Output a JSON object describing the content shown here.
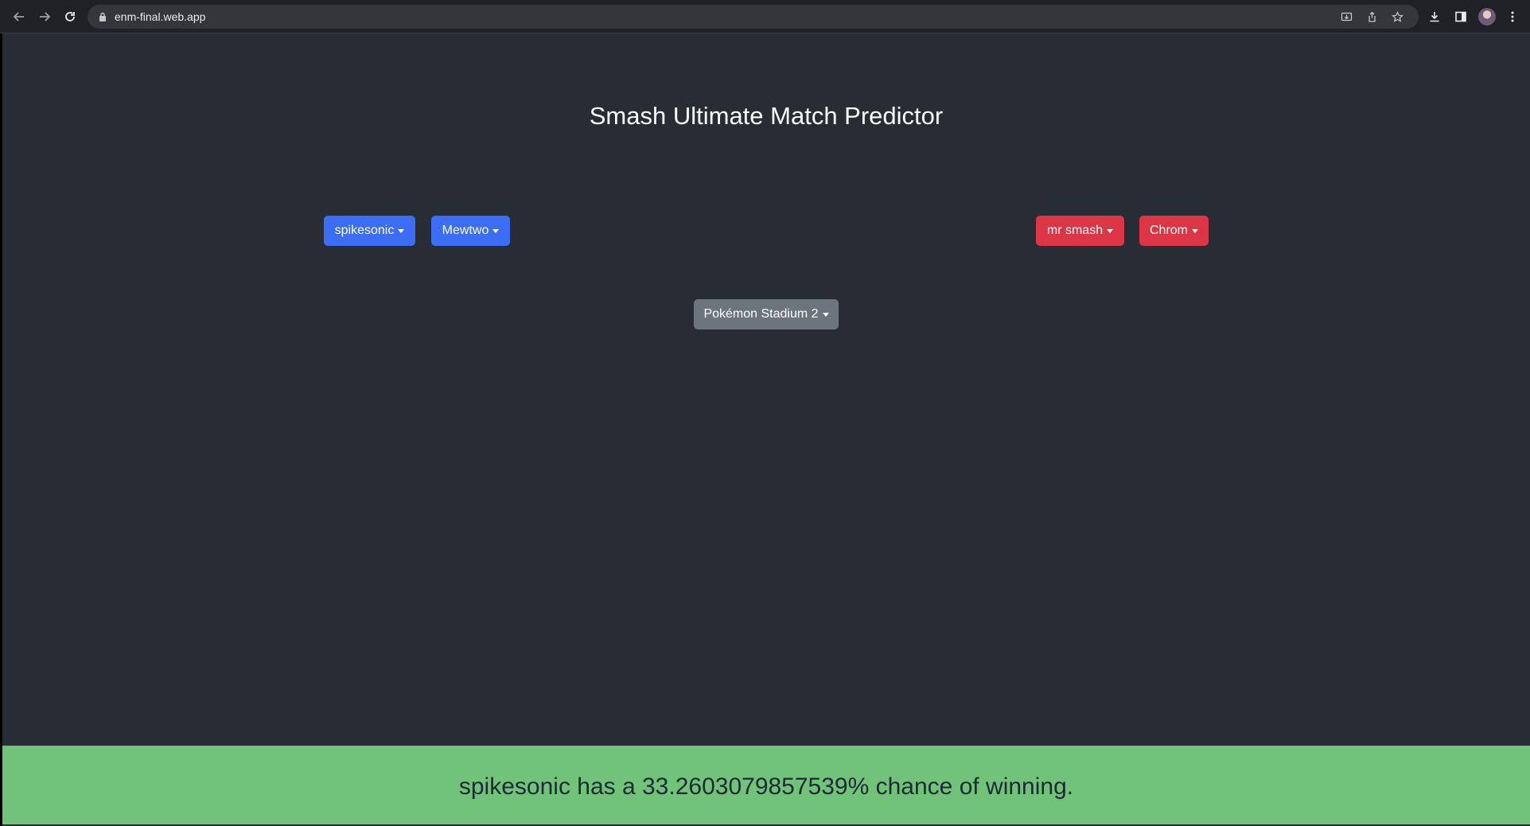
{
  "browser": {
    "url": "enm-final.web.app"
  },
  "page": {
    "title": "Smash Ultimate Match Predictor",
    "player1": {
      "name": "spikesonic",
      "character": "Mewtwo"
    },
    "player2": {
      "name": "mr smash",
      "character": "Chrom"
    },
    "stage": "Pokémon Stadium 2",
    "result": "spikesonic has a 33.2603079857539% chance of winning."
  },
  "colors": {
    "page_bg": "#282c34",
    "player1": "#3b6ef5",
    "player2": "#dc3545",
    "stage": "#6c757d",
    "result_bg": "#70c379"
  }
}
